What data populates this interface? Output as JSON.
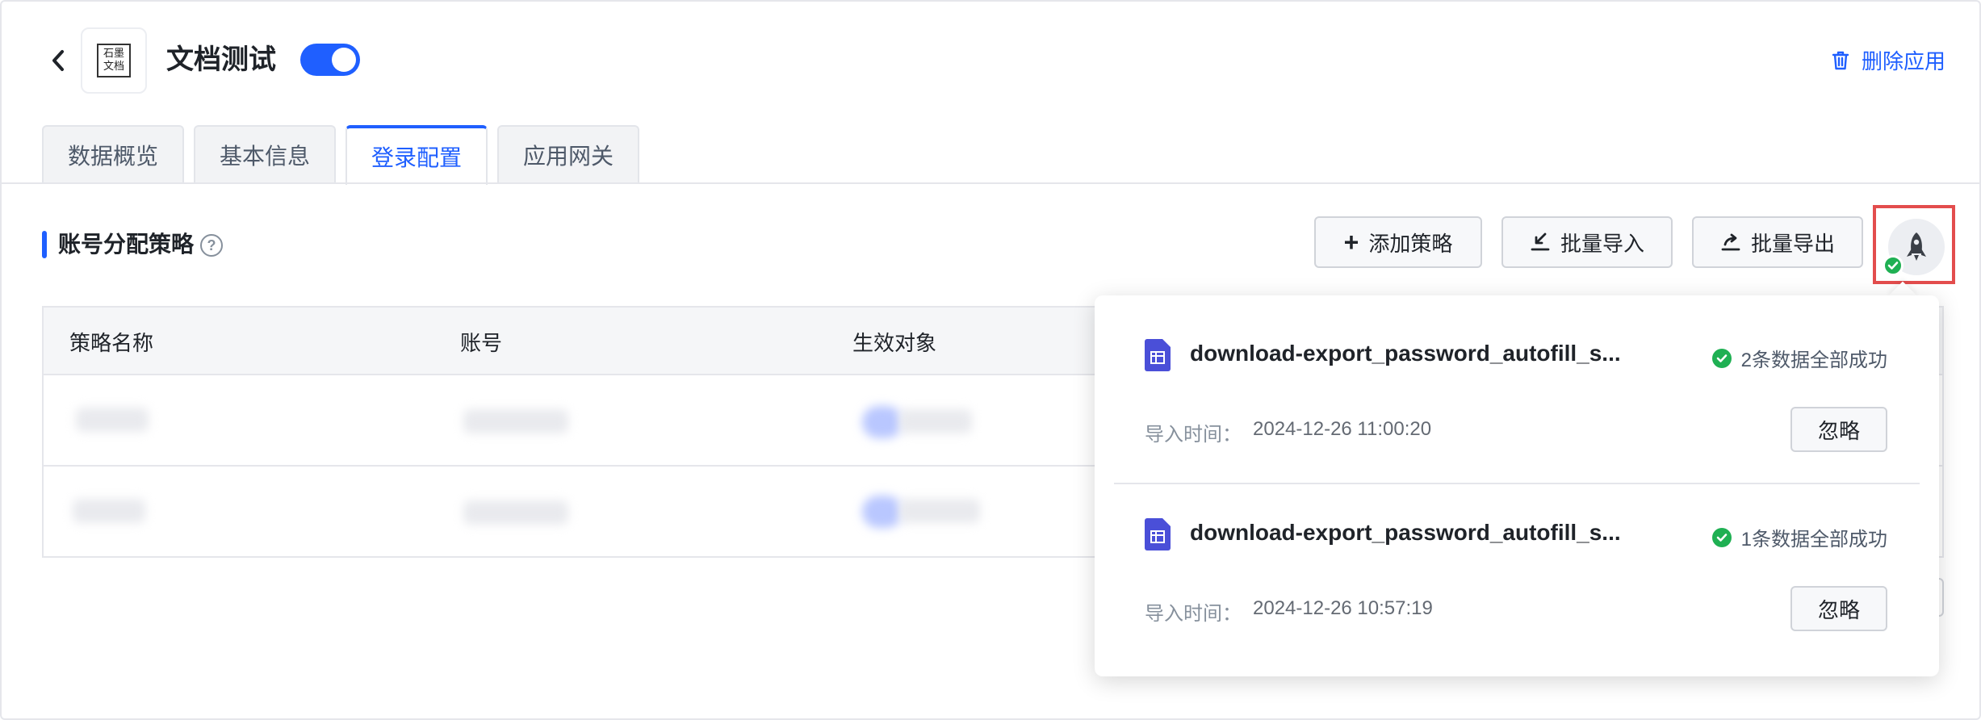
{
  "header": {
    "app_title": "文档测试",
    "app_logo_line1": "石墨",
    "app_logo_line2": "文档",
    "toggle_on": true,
    "delete_app_label": "删除应用"
  },
  "tabs": [
    {
      "label": "数据概览",
      "active": false
    },
    {
      "label": "基本信息",
      "active": false
    },
    {
      "label": "登录配置",
      "active": true
    },
    {
      "label": "应用网关",
      "active": false
    }
  ],
  "section": {
    "title": "账号分配策略",
    "help": "?"
  },
  "toolbar": {
    "add_label": "添加策略",
    "import_label": "批量导入",
    "export_label": "批量导出",
    "add_glyph": "+"
  },
  "table": {
    "columns": [
      "策略名称",
      "账号",
      "生效对象"
    ]
  },
  "import_tasks": {
    "items": [
      {
        "file_name": "download-export_password_autofill_s...",
        "status": "2条数据全部成功",
        "time_label": "导入时间：",
        "time_value": "2024-12-26 11:00:20",
        "ignore_label": "忽略"
      },
      {
        "file_name": "download-export_password_autofill_s...",
        "status": "1条数据全部成功",
        "time_label": "导入时间：",
        "time_value": "2024-12-26 10:57:19",
        "ignore_label": "忽略"
      }
    ]
  },
  "colors": {
    "primary": "#1f5fff",
    "success": "#1fb053",
    "highlight": "#e34d4d"
  }
}
